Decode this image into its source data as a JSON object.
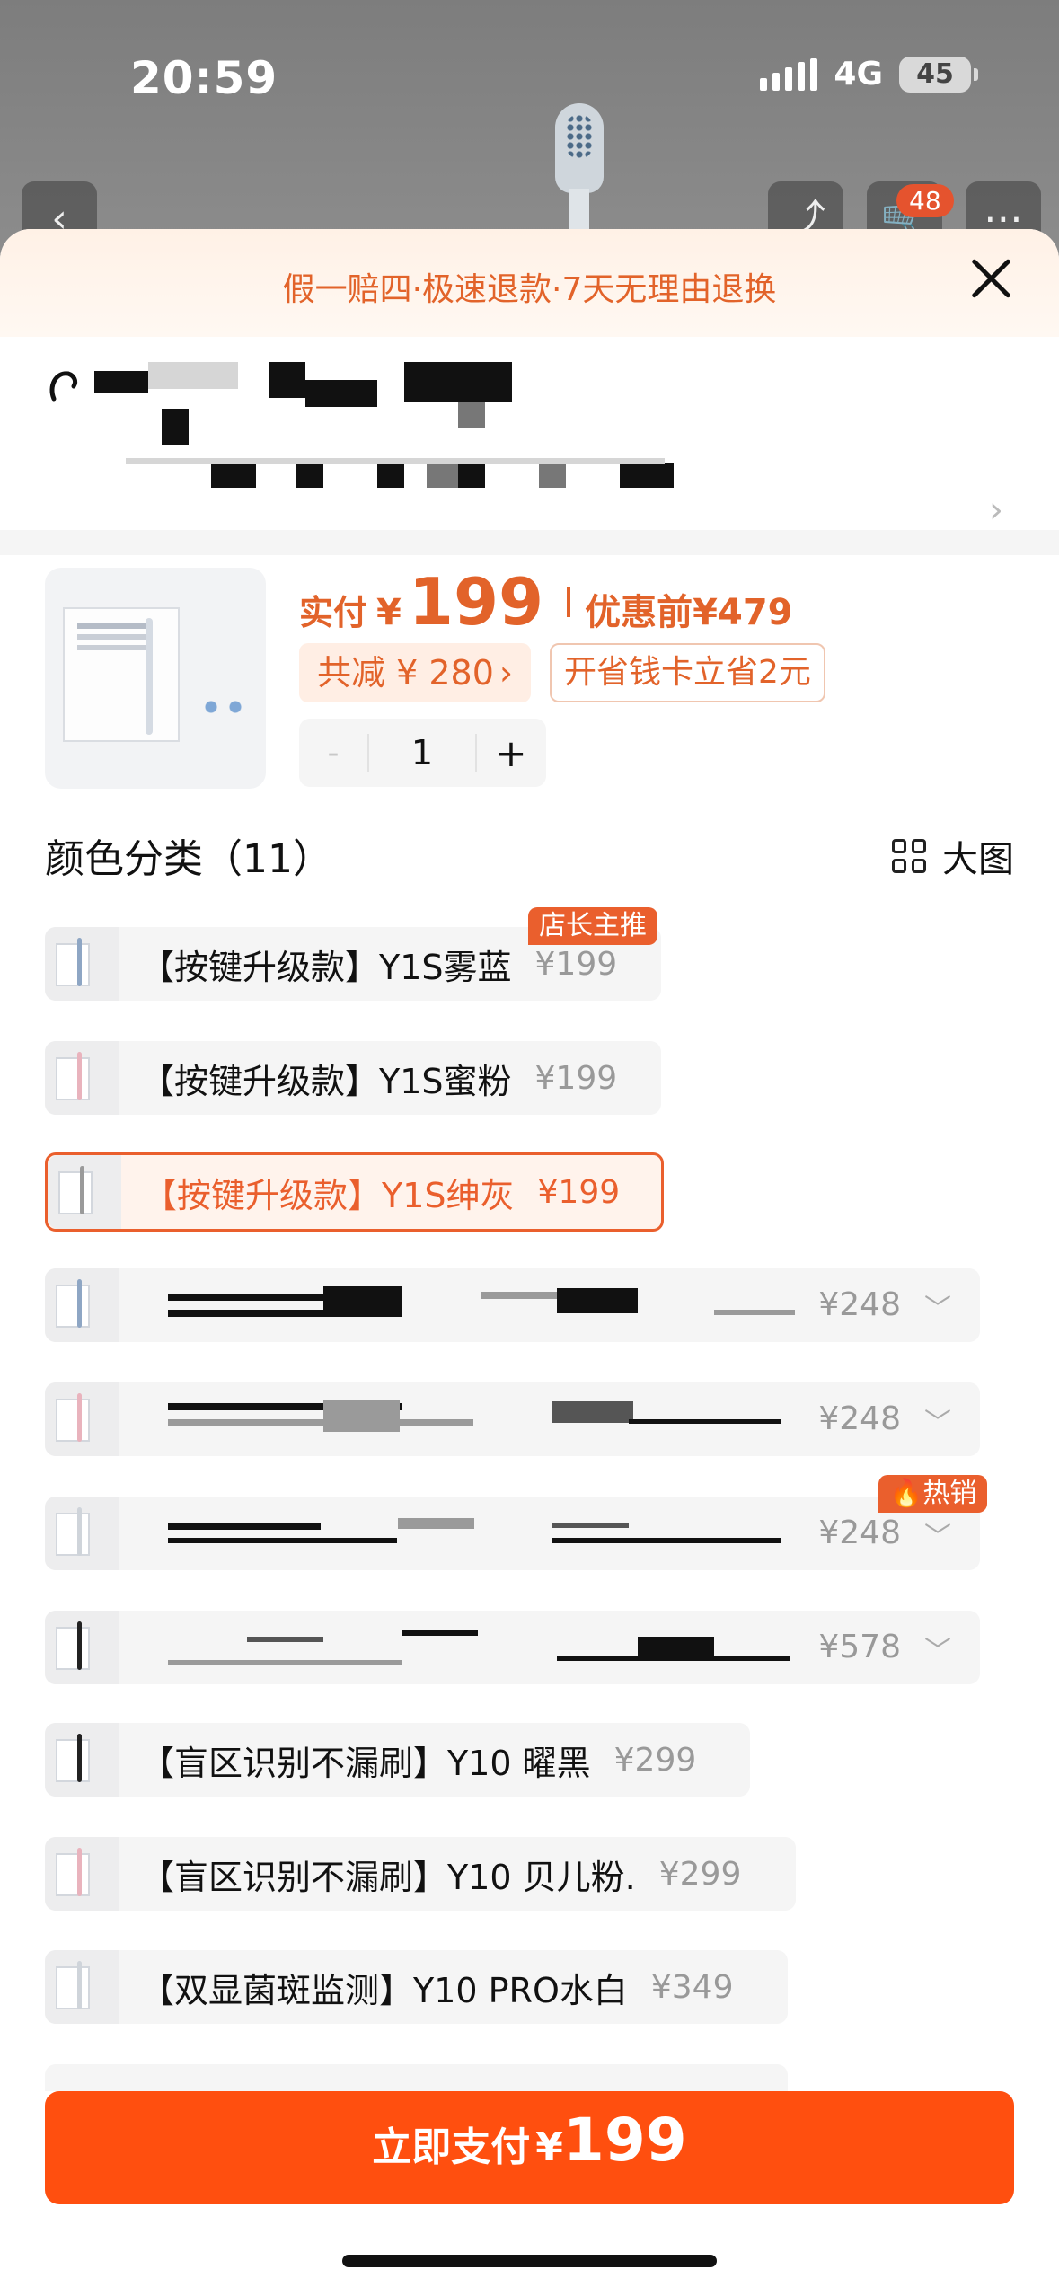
{
  "status_bar": {
    "time": "20:59",
    "network": "4G",
    "battery": "45"
  },
  "nav": {
    "back_icon": "chevron-left-icon",
    "share_icon": "share-icon",
    "cart_badge": "48",
    "more_icon": "more-icon"
  },
  "notice": {
    "text": "假一赔四·极速退款·7天无理由退换"
  },
  "product": {
    "price_label": "实付",
    "currency": "¥",
    "price": "199",
    "original_label": "优惠前",
    "original_price": "¥479",
    "discount_label": "共减 ¥ 280",
    "discount_arrow": "›",
    "saver_card": "开省钱卡立省2元",
    "quantity": "1",
    "minus": "-",
    "plus": "+"
  },
  "variants": {
    "title": "颜色分类（11）",
    "big_view": "大图",
    "items": [
      {
        "label": "【按键升级款】Y1S雾蓝",
        "price": "¥199",
        "tag": "店长主推"
      },
      {
        "label": "【按键升级款】Y1S蜜粉",
        "price": "¥199"
      },
      {
        "label": "【按键升级款】Y1S绅灰",
        "price": "¥199",
        "selected": true
      },
      {
        "label": "",
        "price": "¥248"
      },
      {
        "label": "",
        "price": "¥248"
      },
      {
        "label": "",
        "price": "¥248",
        "tag": "热销"
      },
      {
        "label": "",
        "price": "¥578"
      },
      {
        "label": "【盲区识别不漏刷】Y10 曜黑",
        "price": "¥299"
      },
      {
        "label": "【盲区识别不漏刷】Y10 贝儿粉.",
        "price": "¥299"
      },
      {
        "label": "【双显菌斑监测】Y10 PRO水白",
        "price": "¥349"
      }
    ]
  },
  "footer": {
    "pay_label": "立即支付",
    "currency": "¥",
    "pay_amount": "199"
  },
  "colors": {
    "accent": "#ea5f2d",
    "pay_button": "#ff4f0f",
    "notice_bg": "#fff1e6"
  }
}
